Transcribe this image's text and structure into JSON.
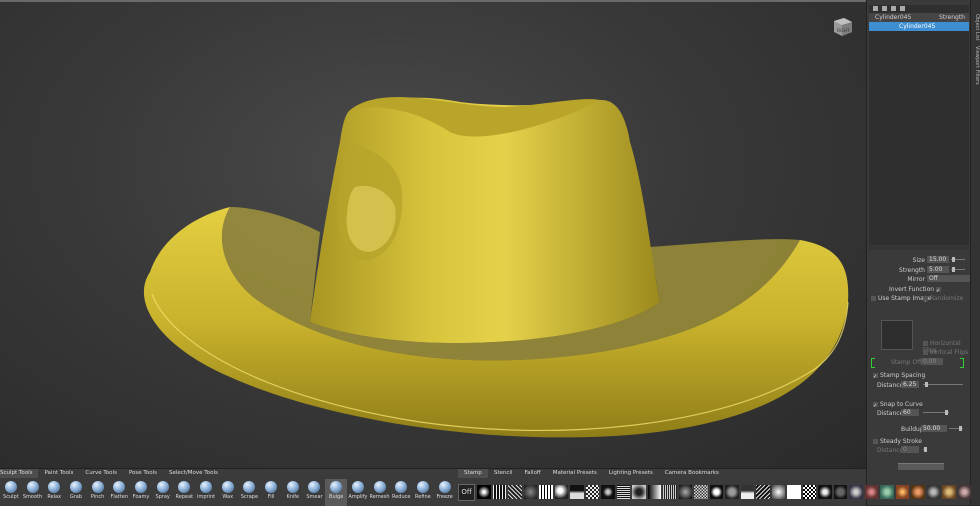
{
  "viewport": {
    "navcube_label": "RGHT",
    "model_color": "#c8b430"
  },
  "scene": {
    "header_name": "Cylinder045",
    "header_col": "Strength",
    "selected_item": "Cylinder045"
  },
  "side_tabs": [
    "Object List",
    "Viewport Filters"
  ],
  "props": {
    "size_label": "Size",
    "size_value": "15.00",
    "strength_label": "Strength",
    "strength_value": "5.00",
    "mirror_label": "Mirror",
    "mirror_value": "Off",
    "invert_label": "Invert Function",
    "use_stamp_label": "Use Stamp Image",
    "randomize_label": "Randomize",
    "hflip_label": "Horizontal Flips",
    "vflip_label": "Vertical Flips",
    "stamp_offset_label": "Stamp Offset",
    "stamp_offset_value": "0.00",
    "stamp_spacing_label": "Stamp Spacing",
    "distance_label": "Distance",
    "distance1_value": "6.25",
    "snap_label": "Snap to Curve",
    "distance2_value": "60",
    "buildup_label": "Buildup",
    "buildup_value": "50.00",
    "steady_label": "Steady Stroke",
    "distance3_value": "0"
  },
  "toolbar": {
    "tabs": [
      "Sculpt Tools",
      "Paint Tools",
      "Curve Tools",
      "Pose Tools",
      "Select/Move Tools"
    ],
    "tools": [
      "Sculpt",
      "Smooth",
      "Relax",
      "Grab",
      "Pinch",
      "Flatten",
      "Foamy",
      "Spray",
      "Repeat",
      "Imprint",
      "Wax",
      "Scrape",
      "Fill",
      "Knife",
      "Smear",
      "Bulge",
      "Amplify",
      "Remesh",
      "Reduce",
      "Refine",
      "Freeze"
    ],
    "active_tool": "Bulge",
    "stamp_tabs": [
      "Stamp",
      "Stencil",
      "Falloff",
      "Material Presets",
      "Lighting Presets",
      "Camera Bookmarks"
    ],
    "stamp_off_label": "Off"
  }
}
